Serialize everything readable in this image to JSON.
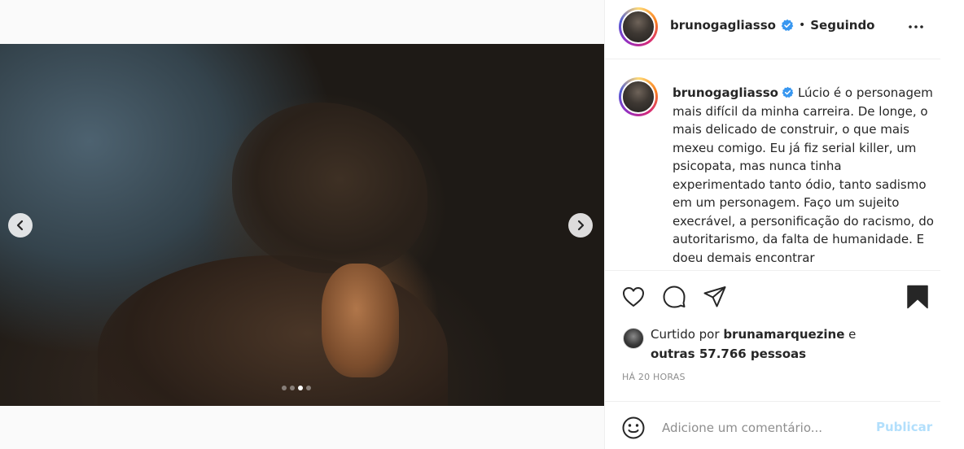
{
  "post": {
    "carousel": {
      "prev_icon": "chevron-left-icon",
      "next_icon": "chevron-right-icon",
      "total_slides": 4,
      "active_slide": 3
    },
    "header": {
      "username": "brunogagliasso",
      "separator": "•",
      "follow_status": "Seguindo",
      "more_icon": "more-horizontal-icon"
    },
    "caption": {
      "username": "brunogagliasso",
      "text": "Lúcio é o personagem mais difícil da minha carreira. De longe, o mais delicado de construir, o que mais mexeu comigo. Eu já fiz serial killer, um psicopata, mas nunca tinha experimentado tanto ódio, tanto sadismo em um personagem. Faço um sujeito execrável, a personificação do racismo, do autoritarismo, da falta de humanidade. E doeu demais encontrar"
    },
    "likes": {
      "prefix": "Curtido por",
      "liker": "brunamarquezine",
      "conjunction": "e",
      "others": "outras 57.766 pessoas"
    },
    "timestamp": "HÁ 20 HORAS",
    "comment": {
      "placeholder": "Adicione um comentário...",
      "submit_label": "Publicar"
    }
  },
  "colors": {
    "verified_blue": "#3897f0",
    "publish_disabled": "#b2dffc",
    "muted_text": "#8e8e8e",
    "text": "#262626"
  }
}
